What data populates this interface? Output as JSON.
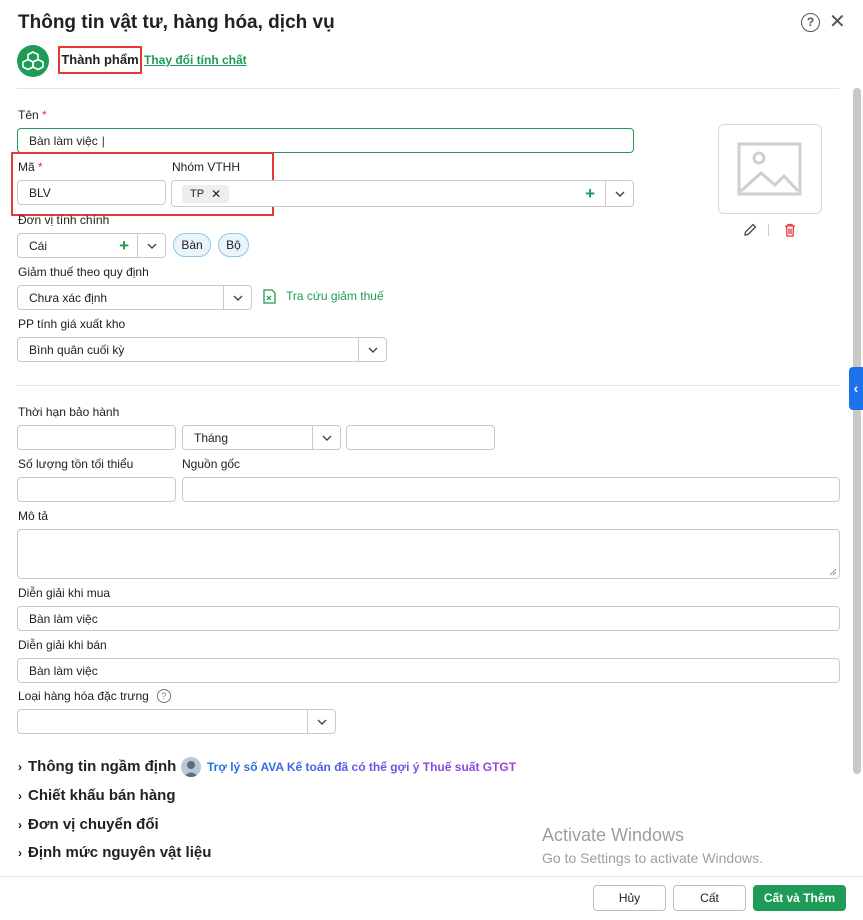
{
  "dialog": {
    "title": "Thông tin vật tư, hàng hóa, dịch vụ",
    "type_label": "Thành phẩm",
    "change_type_link": "Thay đổi tính chất"
  },
  "form": {
    "ten_label": "Tên",
    "ten_value": "Bàn làm việc",
    "ma_label": "Mã",
    "ma_value": "BLV",
    "nhom_label": "Nhóm VTHH",
    "nhom_tag": "TP",
    "don_vi_label": "Đơn vị tính chính",
    "don_vi_value": "Cái",
    "don_vi_chips": [
      "Bàn",
      "Bộ"
    ],
    "giam_thue_label": "Giảm thuế theo quy định",
    "giam_thue_value": "Chưa xác định",
    "tra_cuu_link": "Tra cứu giảm thuế",
    "pp_label": "PP tính giá xuất kho",
    "pp_value": "Bình quân cuối kỳ",
    "bao_hanh_label": "Thời hạn bảo hành",
    "bao_hanh_unit": "Tháng",
    "ton_label": "Số lượng tồn tối thiểu",
    "nguon_goc_label": "Nguồn gốc",
    "mo_ta_label": "Mô tả",
    "mua_label": "Diễn giải khi mua",
    "mua_value": "Bàn làm việc",
    "ban_label": "Diễn giải khi bán",
    "ban_value": "Bàn làm việc",
    "loai_label": "Loại hàng hóa đặc trưng"
  },
  "sections": {
    "ngam_dinh": "Thông tin ngầm định",
    "ava_hint": "Trợ lý số AVA Kế toán đã có thể gợi ý Thuế suất GTGT",
    "chiet_khau": "Chiết khấu bán hàng",
    "chuyen_doi": "Đơn vị chuyển đổi",
    "dinh_muc": "Định mức nguyên vật liệu"
  },
  "watermark": {
    "line1": "Activate Windows",
    "line2": "Go to Settings to activate Windows."
  },
  "footer": {
    "cancel": "Hủy",
    "save": "Cất",
    "save_add": "Cất và Thêm"
  },
  "colors": {
    "accent": "#1e9b56",
    "required": "#e53935",
    "highlight": "#e53935",
    "link_blue": "#1a73e8"
  }
}
